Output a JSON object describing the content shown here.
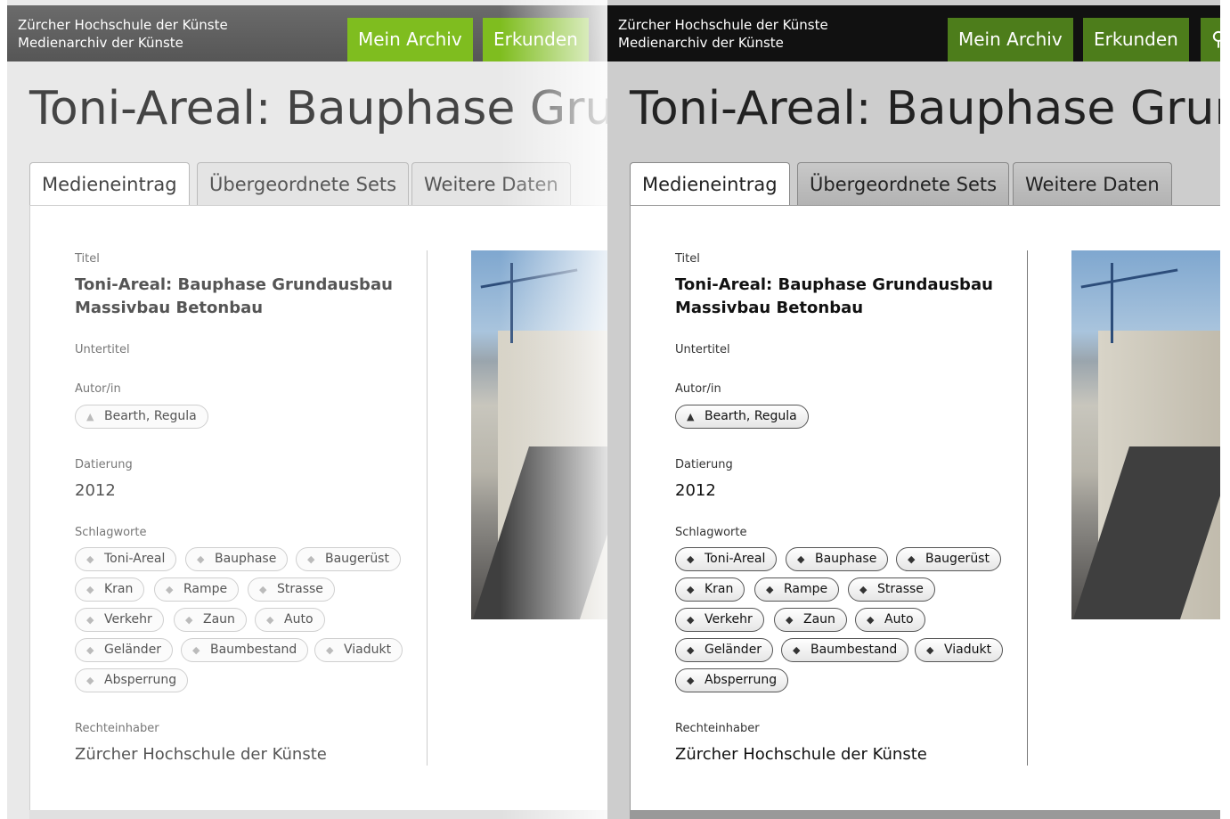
{
  "header": {
    "brand_line1": "Zürcher Hochschule der Künste",
    "brand_line2": "Medienarchiv der Künste",
    "nav": [
      "Mein Archiv",
      "Erkunden"
    ],
    "search_icon": "search-icon"
  },
  "page": {
    "title": "Toni-Areal: Bauphase Grundausbau Massivbau Betonbau",
    "tabs": [
      "Medieneintrag",
      "Übergeordnete Sets",
      "Weitere Daten"
    ]
  },
  "entry": {
    "title_label": "Titel",
    "title_line1": "Toni-Areal: Bauphase Grundausbau",
    "title_line2": "Massivbau Betonbau",
    "subtitle_label": "Untertitel",
    "author_label": "Autor/in",
    "author": "Bearth, Regula",
    "date_label": "Datierung",
    "date": "2012",
    "keywords_label": "Schlagworte",
    "keywords": [
      "Toni-Areal",
      "Bauphase",
      "Baugerüst",
      "Kran",
      "Rampe",
      "Strasse",
      "Verkehr",
      "Zaun",
      "Auto",
      "Geländer",
      "Baumbestand",
      "Viadukt",
      "Absperrung"
    ],
    "rights_label": "Rechteinhaber",
    "rights": "Zürcher Hochschule der Künste"
  },
  "colors": {
    "accent_light": "#7fbd1f",
    "accent_dark": "#4d7d1b"
  }
}
